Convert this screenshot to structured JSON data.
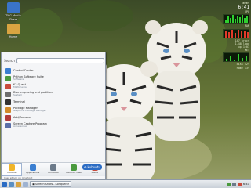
{
  "desktop": {
    "icons": [
      {
        "label": "TNG Media",
        "sub": "Share",
        "color": "#3a74c9"
      },
      {
        "label": "Home",
        "sub": "",
        "color": "#d9a441"
      }
    ]
  },
  "monitor": {
    "header": "pm9m9",
    "clock": "6:41",
    "cpu_label": "CPU",
    "ram_label": "RAM",
    "net_label": "NET",
    "lines": [
      "147 procs",
      "1.48 load",
      "up 1:03",
      "disk 42%",
      "home 13%"
    ]
  },
  "menu": {
    "search_label": "Search",
    "search_placeholder": "",
    "items": [
      {
        "title": "Control Center",
        "subtitle": "",
        "color": "#3b7fd1"
      },
      {
        "title": "Python Software Suite",
        "subtitle": "Software",
        "color": "#4a9a3e"
      },
      {
        "title": "K3 Quest",
        "subtitle": "Multimedia",
        "color": "#c94a3b"
      },
      {
        "title": "Disc engraving and partition",
        "subtitle": "System",
        "color": "#6d6d6d"
      },
      {
        "title": "Terminal",
        "subtitle": "",
        "color": "#333333"
      },
      {
        "title": "Package Manager",
        "subtitle": "Graphical Package Manager",
        "color": "#d28a2a"
      },
      {
        "title": "Add/Remove",
        "subtitle": "",
        "color": "#b23a3a"
      },
      {
        "title": "Screen Capture Program",
        "subtitle": "Accessories",
        "color": "#5a6fa8"
      }
    ],
    "tabs": [
      {
        "label": "Favorites",
        "color": "#f0b52a"
      },
      {
        "label": "Applications",
        "color": "#3b7fd1"
      },
      {
        "label": "Computer",
        "color": "#6c7a8a"
      },
      {
        "label": "Recently Used",
        "color": "#4a9a3e"
      },
      {
        "label": "Leave",
        "color": "#c94a3b"
      }
    ],
    "footer": "User eltoon on localhost",
    "brand": "kubuntu"
  },
  "taskbar": {
    "tasks": [
      "Screen Shots - Konqueror"
    ],
    "clock": "6:41"
  }
}
